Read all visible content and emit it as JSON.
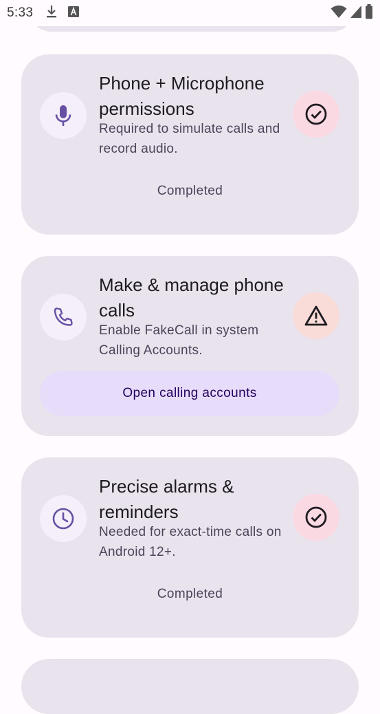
{
  "status_bar": {
    "time": "5:33",
    "icons": [
      "download-icon",
      "keyboard-a-icon",
      "wifi-icon",
      "signal-icon",
      "battery-icon"
    ]
  },
  "colors": {
    "card_bg": "#e9e3ee",
    "accent_purple": "#6750a4",
    "done_bg": "#fbd9e3",
    "warn_bg": "#f9dcd8",
    "button_bg": "#e8dcfb"
  },
  "cards": [
    {
      "icon": "microphone-icon",
      "title": "Phone + Microphone permissions",
      "description": "Required to simulate calls and record audio.",
      "status_icon": "check-circle-icon",
      "footer": "Completed"
    },
    {
      "icon": "phone-icon",
      "title": "Make & manage phone calls",
      "description": "Enable FakeCall in system Calling Accounts.",
      "status_icon": "warning-icon",
      "button_label": "Open calling accounts"
    },
    {
      "icon": "clock-icon",
      "title": "Precise alarms & reminders",
      "description": "Needed for exact-time calls on Android 12+.",
      "status_icon": "check-circle-icon",
      "footer": "Completed"
    }
  ]
}
